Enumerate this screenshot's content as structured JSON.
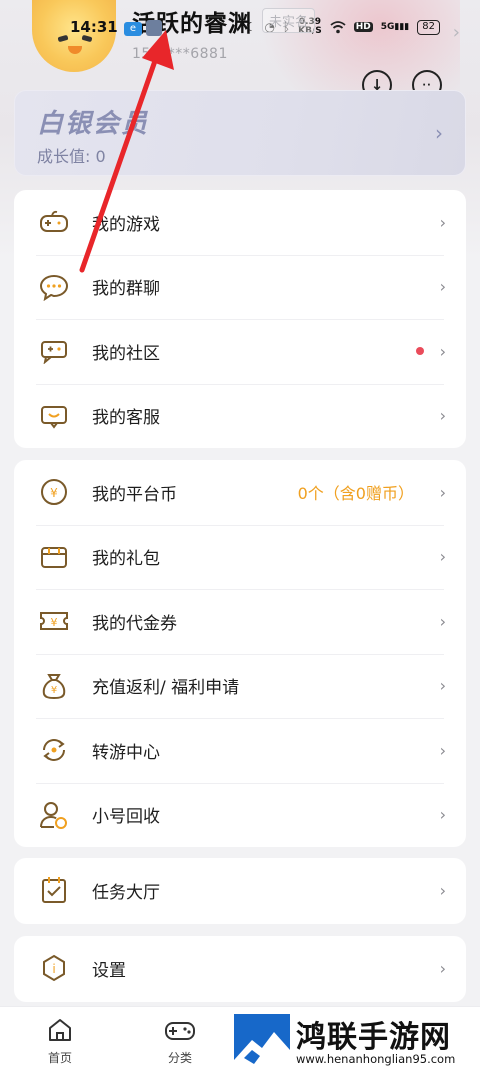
{
  "status_bar": {
    "time": "14:31",
    "speed_value": "0.39",
    "speed_unit": "KB/S",
    "hd": "HD",
    "signal": "5G",
    "battery": "82"
  },
  "profile": {
    "username": "活跃的睿渊",
    "verify_badge": "未实名",
    "phone": "159****6881",
    "tag": "e"
  },
  "member_card": {
    "title": "白银会员",
    "growth": "成长值: 0"
  },
  "menu_group_1": [
    {
      "label": "我的游戏",
      "icon": "gamepad-icon"
    },
    {
      "label": "我的群聊",
      "icon": "chat-bubble-icon"
    },
    {
      "label": "我的社区",
      "icon": "community-icon"
    },
    {
      "label": "我的客服",
      "icon": "customer-service-icon"
    }
  ],
  "menu_group_2": [
    {
      "label": "我的平台币",
      "icon": "coin-icon",
      "extra": "0个（含0赠币）"
    },
    {
      "label": "我的礼包",
      "icon": "gift-icon"
    },
    {
      "label": "我的代金券",
      "icon": "voucher-icon"
    },
    {
      "label": "充值返利/ 福利申请",
      "icon": "money-bag-icon"
    },
    {
      "label": "转游中心",
      "icon": "transfer-icon"
    },
    {
      "label": "小号回收",
      "icon": "account-recycle-icon"
    }
  ],
  "menu_group_3": [
    {
      "label": "任务大厅",
      "icon": "task-icon"
    }
  ],
  "menu_group_4": [
    {
      "label": "设置",
      "icon": "settings-icon"
    }
  ],
  "bottom_nav": [
    {
      "label": "首页",
      "icon": "home-icon"
    },
    {
      "label": "分类",
      "icon": "gamepad-icon"
    }
  ],
  "watermark": {
    "brand": "鸿联手游网",
    "url": "www.henanhonglian95.com"
  },
  "colors": {
    "accent_orange": "#f0a020",
    "icon_brown": "#7a5a2a",
    "dot_red": "#ea4b5a",
    "arrow_red": "#e8262a"
  }
}
